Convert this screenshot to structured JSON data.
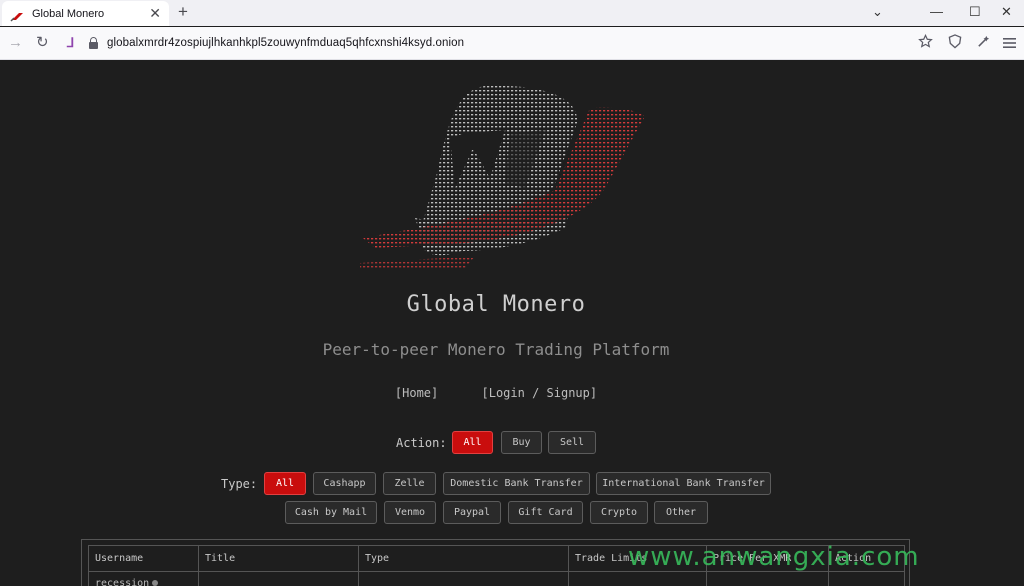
{
  "browser": {
    "tab_title": "Global Monero",
    "tab_close": "✕",
    "new_tab": "+",
    "url": "globalxmrdr4zospiujlhkanhkpl5zouwynfmduaq5qhfcxnshi4ksyd.onion",
    "window_controls": {
      "minimize": "—",
      "maximize": "☐",
      "close": "✕",
      "list": "⌄"
    },
    "nav": {
      "back": "→",
      "reload": "↻",
      "tor": "⅃"
    }
  },
  "site": {
    "title": "Global Monero",
    "subtitle": "Peer-to-peer Monero Trading Platform",
    "links": [
      "[Home]",
      "[Login / Signup]"
    ]
  },
  "filters": {
    "action_label": "Action:",
    "actions": [
      "All",
      "Buy",
      "Sell"
    ],
    "type_label": "Type:",
    "types_row1": [
      "All",
      "Cashapp",
      "Zelle",
      "Domestic Bank Transfer",
      "International Bank Transfer"
    ],
    "types_row2": [
      "Cash by Mail",
      "Venmo",
      "Paypal",
      "Gift Card",
      "Crypto",
      "Other"
    ]
  },
  "table": {
    "headers": [
      "Username",
      "Title",
      "Type",
      "Trade Limits",
      "Price Per XMR",
      "Action"
    ],
    "first_row_username": "recession"
  },
  "watermark": "www.anwangxia.com",
  "colors": {
    "accent": "#c90d0d",
    "page_bg": "#1e1e1e",
    "watermark": "#38b85a"
  }
}
